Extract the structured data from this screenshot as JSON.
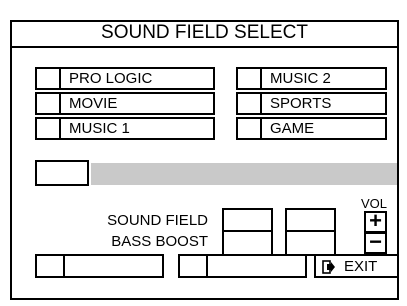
{
  "window": {
    "title": "SOUND FIELD SELECT"
  },
  "modes": {
    "left": [
      "PRO LOGIC",
      "MOVIE",
      "MUSIC 1"
    ],
    "right": [
      "MUSIC 2",
      "SPORTS",
      "GAME"
    ]
  },
  "controls": {
    "sound_field_label": "SOUND FIELD",
    "bass_boost_label": "BASS BOOST",
    "vol_label": "VOL",
    "vol_up": "+",
    "vol_down": "−"
  },
  "footer": {
    "exit_label": "EXIT"
  },
  "icons": {
    "exit": "exit-arrow-icon"
  }
}
